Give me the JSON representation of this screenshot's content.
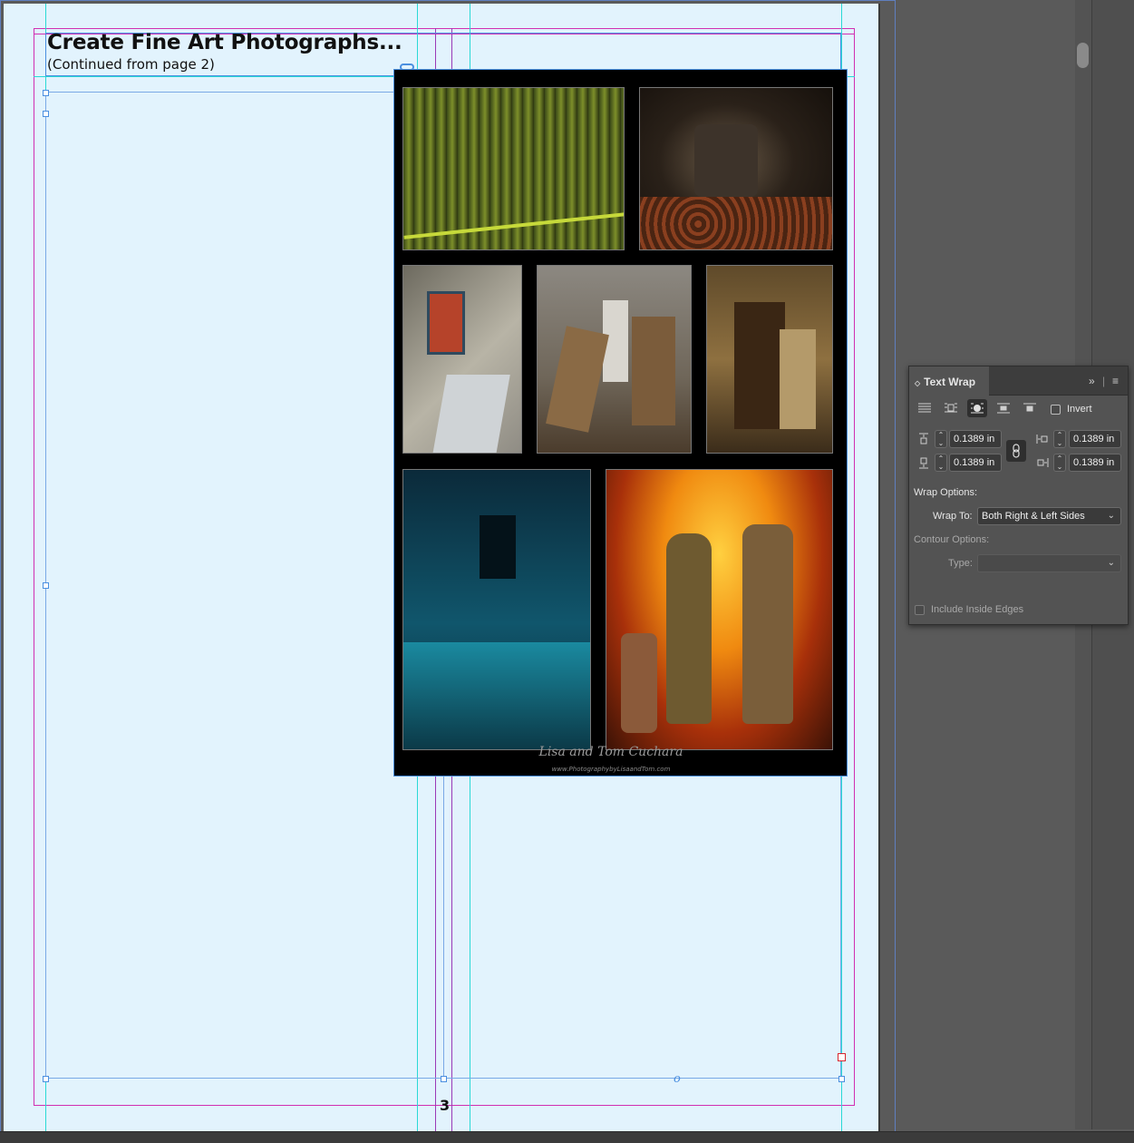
{
  "document": {
    "headline": "Create Fine Art Photographs...",
    "subhead": "(Continued from page 2)",
    "page_number": "3",
    "signature": "Lisa and Tom Cuchara",
    "signature_url": "www.PhotographybyLisaandTom.com"
  },
  "photos": [
    {
      "name": "factory-spools-photo",
      "tone": "green"
    },
    {
      "name": "watering-can-photo",
      "tone": "brown"
    },
    {
      "name": "red-doorway-photo",
      "tone": "gray"
    },
    {
      "name": "wooden-doors-photo",
      "tone": "tan"
    },
    {
      "name": "stairwell-door-photo",
      "tone": "amber"
    },
    {
      "name": "blue-corridor-photo",
      "tone": "blue"
    },
    {
      "name": "fire-bottles-photo",
      "tone": "orange"
    }
  ],
  "text_wrap_panel": {
    "title": "Text Wrap",
    "invert_label": "Invert",
    "invert_checked": false,
    "top_offset": "0.1389 in",
    "bottom_offset": "0.1389 in",
    "left_offset": "0.1389 in",
    "right_offset": "0.1389 in",
    "wrap_options_label": "Wrap Options:",
    "wrap_to_label": "Wrap To:",
    "wrap_to_value": "Both Right & Left Sides",
    "contour_options_label": "Contour Options:",
    "type_label": "Type:",
    "type_value": "",
    "include_inside_edges_label": "Include Inside Edges",
    "include_inside_edges_checked": false,
    "active_wrap_mode": "wrap-around-object-shape"
  },
  "colors": {
    "margin_guide": "#d12fb2",
    "column_guide": "#9a3ab8",
    "ruler_guide": "#29d9d6",
    "frame_selection": "#4a8fe0",
    "page_background": "#e2f3fd",
    "pasteboard": "#5a5a5a"
  }
}
